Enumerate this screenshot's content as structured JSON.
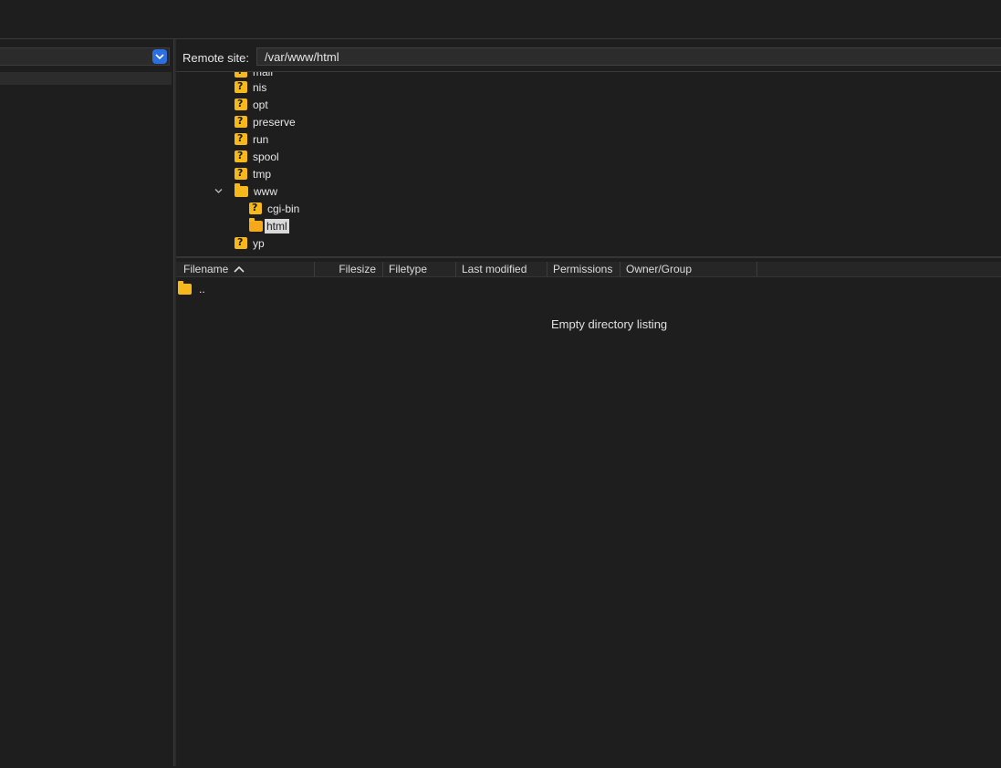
{
  "remote": {
    "label": "Remote site:",
    "path": "/var/www/html"
  },
  "tree": {
    "partial_top": "mail",
    "items": [
      {
        "label": "nis",
        "icon": "unknown-folder-icon"
      },
      {
        "label": "opt",
        "icon": "unknown-folder-icon"
      },
      {
        "label": "preserve",
        "icon": "unknown-folder-icon"
      },
      {
        "label": "run",
        "icon": "unknown-folder-icon"
      },
      {
        "label": "spool",
        "icon": "unknown-folder-icon"
      },
      {
        "label": "tmp",
        "icon": "unknown-folder-icon"
      },
      {
        "label": "www",
        "icon": "folder-icon",
        "expanded": true
      },
      {
        "label": "cgi-bin",
        "icon": "unknown-folder-icon"
      },
      {
        "label": "html",
        "icon": "open-folder-icon",
        "selected": true
      },
      {
        "label": "yp",
        "icon": "unknown-folder-icon"
      }
    ]
  },
  "columns": {
    "filename": "Filename",
    "filesize": "Filesize",
    "filetype": "Filetype",
    "last_modified": "Last modified",
    "permissions": "Permissions",
    "owner_group": "Owner/Group"
  },
  "files": [
    {
      "name": ".."
    }
  ],
  "empty_message": "Empty directory listing",
  "colors": {
    "background": "#1e1e1e",
    "folder": "#f6b81a",
    "accent": "#2d6fe0"
  }
}
